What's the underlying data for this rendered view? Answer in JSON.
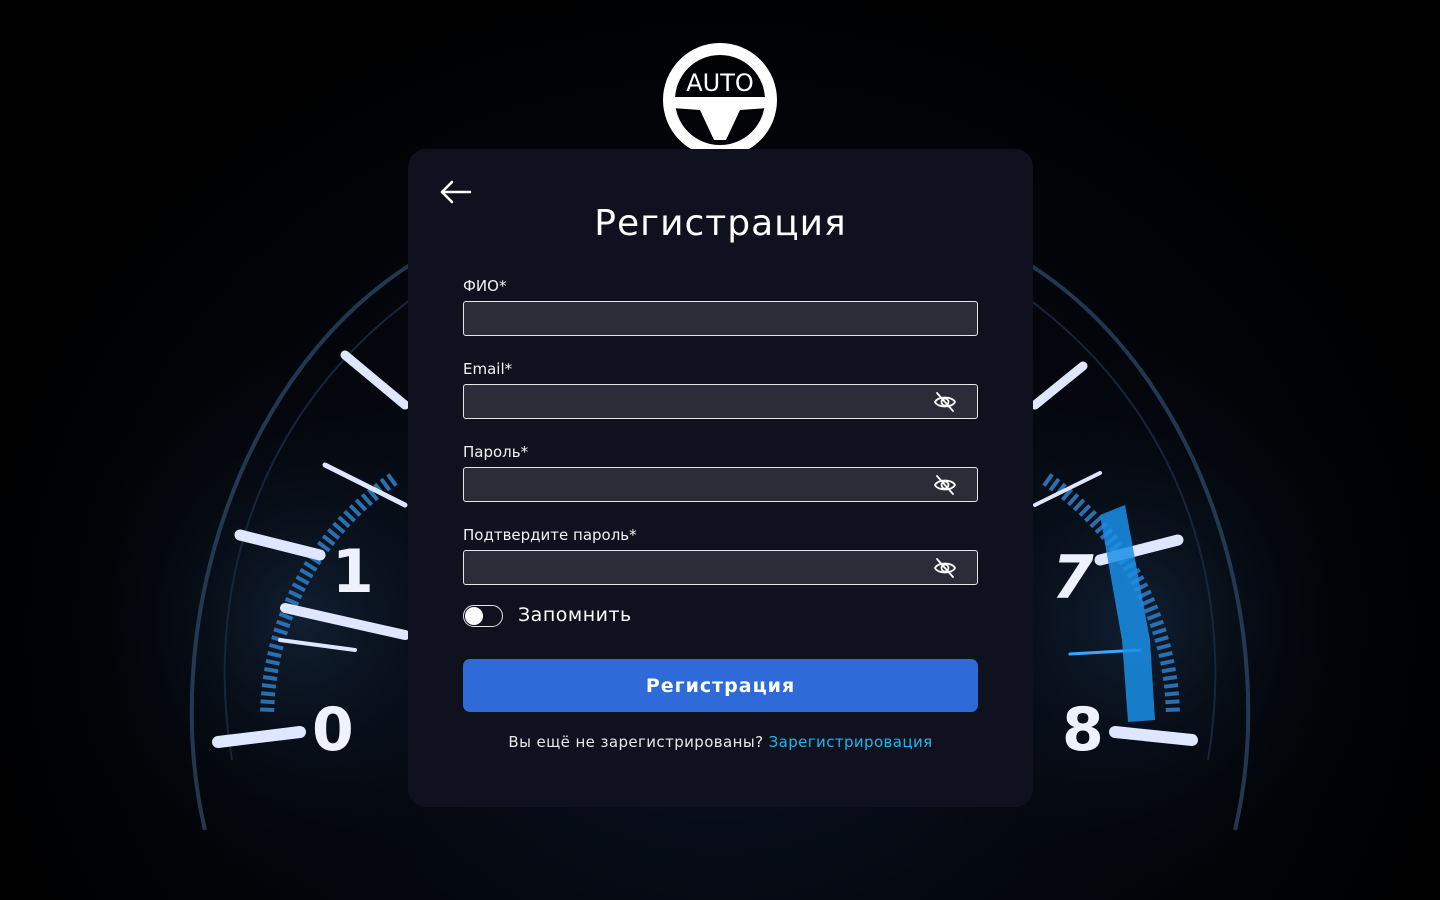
{
  "colors": {
    "card_bg": "#10111e",
    "field_bg": "#2a2c38",
    "accent_button": "#2f6bd8",
    "link": "#19b7f0",
    "gauge_blue": "#1e8ee8"
  },
  "logo": {
    "text": "AUTO",
    "icon": "steering-wheel-icon"
  },
  "gauge": {
    "left_numbers": [
      "1",
      "0"
    ],
    "right_numbers": [
      "7",
      "8"
    ]
  },
  "form": {
    "back_icon": "arrow-left-icon",
    "title": "Регистрация",
    "fields": [
      {
        "label": "ФИО*",
        "value": "",
        "has_eye": false
      },
      {
        "label": "Email*",
        "value": "",
        "has_eye": true,
        "eye_icon": "eye-off-icon"
      },
      {
        "label": "Пароль*",
        "value": "",
        "has_eye": true,
        "eye_icon": "eye-off-icon"
      },
      {
        "label": "Подтвердите пароль*",
        "value": "",
        "has_eye": true,
        "eye_icon": "eye-off-icon"
      }
    ],
    "remember": {
      "label": "Запомнить",
      "checked": false
    },
    "submit_label": "Регистрация",
    "footer": {
      "question": "Вы ещё не зарегистрированы?",
      "link": "Зарегистрировация"
    }
  }
}
